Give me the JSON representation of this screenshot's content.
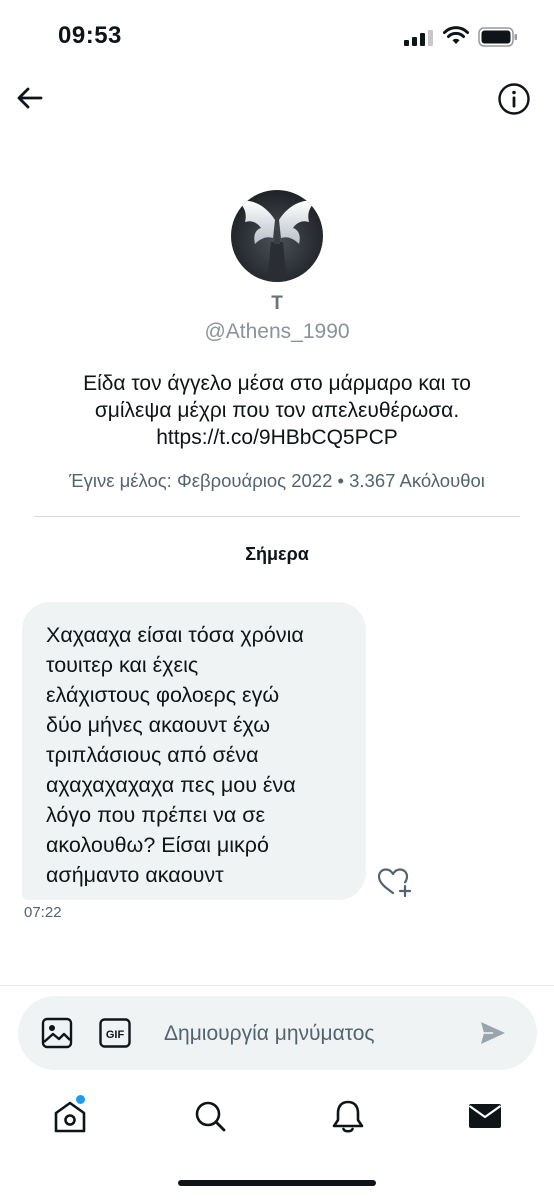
{
  "status_bar": {
    "time": "09:53"
  },
  "profile": {
    "name": "T",
    "handle": "@Athens_1990",
    "bio_lines": [
      "Είδα τον άγγελο μέσα στο μάρμαρο και το",
      "σμίλεψα μέχρι που τον απελευθέρωσα.",
      "https://t.co/9HBbCQ5PCP"
    ],
    "meta": "Έγινε μέλος: Φεβρουάριος 2022 • 3.367 Ακόλουθοι"
  },
  "conversation": {
    "day_label": "Σήμερα",
    "message": {
      "lines": [
        "Χαχααχα είσαι τόσα χρόνια",
        "τουιτερ και έχεις",
        "ελάχιστους φολοερς εγώ",
        "δύο μήνες ακαουντ έχω",
        "τριπλάσιους από σένα",
        "αχαχαχαχαχα πες μου ένα",
        "λόγο που πρέπει να σε",
        "ακολουθω? Είσαι μικρό",
        "ασήμαντο ακαουντ"
      ],
      "time": "07:22"
    }
  },
  "composer": {
    "placeholder": "Δημιουργία μηνύματος",
    "gif_label": "GIF"
  },
  "icons": {
    "back": "arrow-left-icon",
    "info": "info-icon",
    "react": "heart-plus-icon",
    "image": "image-icon",
    "gif": "gif-icon",
    "send": "send-icon",
    "tabs": [
      "home-icon",
      "search-icon",
      "bell-icon",
      "mail-icon"
    ]
  },
  "colors": {
    "accent": "#1d9bf0",
    "bubble": "#eff3f4",
    "secondary_text": "#536471"
  }
}
